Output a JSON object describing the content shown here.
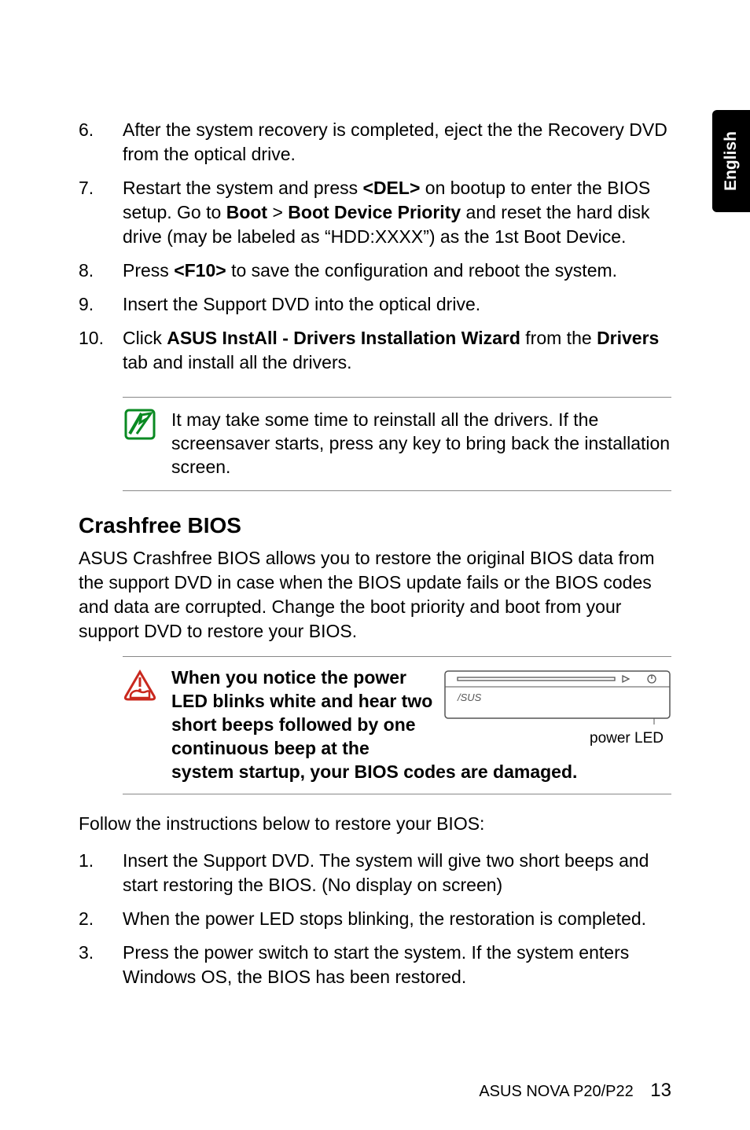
{
  "side_tab": "English",
  "steps_a": [
    {
      "num": "6.",
      "html": "After the system recovery is completed, eject the the Recovery DVD from the optical drive."
    },
    {
      "num": "7.",
      "html": "Restart the system and press <span class=\"bold\">&lt;DEL&gt;</span> on bootup to enter the BIOS setup. Go to <span class=\"bold\">Boot</span> &gt; <span class=\"bold\">Boot Device Priority</span> and reset the hard disk drive (may be labeled as “HDD:XXXX”) as the 1st Boot Device."
    },
    {
      "num": "8.",
      "html": "Press <span class=\"bold\">&lt;F10&gt;</span> to save the configuration and reboot the system."
    },
    {
      "num": "9.",
      "html": "Insert the Support DVD into the optical drive."
    },
    {
      "num": "10.",
      "html": "Click <span class=\"bold\">ASUS InstAll - Drivers Installation Wizard</span> from the <span class=\"bold\">Drivers</span> tab and install all the drivers."
    }
  ],
  "note": "It may take some time to reinstall all the drivers. If the screensaver starts, press any key to bring back the installation screen.",
  "section_title": "Crashfree BIOS",
  "section_para": "ASUS Crashfree BIOS allows you to restore the original BIOS data from the support DVD in case when the BIOS update fails or the BIOS codes and data are corrupted. Change the boot priority and boot from your support DVD to restore your BIOS.",
  "warn_text": "When you notice the power LED blinks white and hear two short beeps followed by one continuous beep at the system startup, your BIOS codes are damaged.",
  "diagram_caption": "power LED",
  "follow_para": "Follow the instructions below to restore your BIOS:",
  "steps_b": [
    {
      "num": "1.",
      "html": "Insert the Support DVD. The system will give two short beeps and start restoring the BIOS. (No display on screen)"
    },
    {
      "num": "2.",
      "html": "When the power LED stops blinking, the restoration is completed."
    },
    {
      "num": "3.",
      "html": "Press the power switch to start the system. If the system enters Windows OS, the BIOS has been restored."
    }
  ],
  "footer_text": "ASUS NOVA P20/P22",
  "footer_page": "13",
  "icons": {
    "note": "note-icon",
    "warn": "warn-icon"
  }
}
